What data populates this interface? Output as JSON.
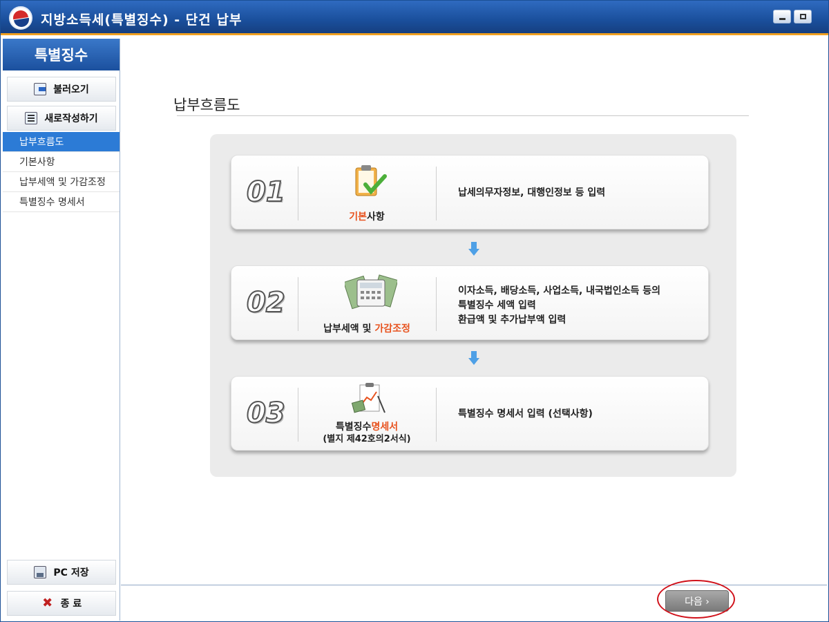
{
  "window": {
    "title": "지방소득세(특별징수) - 단건 납부"
  },
  "sidebar": {
    "header": "특별징수",
    "load_label": "불러오기",
    "new_label": "새로작성하기",
    "items": [
      {
        "label": "납부흐름도",
        "active": true
      },
      {
        "label": "기본사항",
        "active": false
      },
      {
        "label": "납부세액 및 가감조정",
        "active": false
      },
      {
        "label": "특별징수 명세서",
        "active": false
      }
    ],
    "save_label": "PC 저장",
    "exit_label": "종 료"
  },
  "main": {
    "title": "납부흐름도",
    "steps": [
      {
        "number": "01",
        "label_highlight": "기본",
        "label_rest": "사항",
        "icon": "clipboard-check-icon",
        "desc": [
          "납세의무자정보, 대행인정보 등 입력"
        ]
      },
      {
        "number": "02",
        "label_plain": "납부세액 및 ",
        "label_highlight": "가감조정",
        "icon": "calculator-money-icon",
        "desc": [
          "이자소득, 배당소득, 사업소득, 내국법인소득 등의",
          "특별징수 세액 입력",
          "환급액 및 추가납부액 입력"
        ]
      },
      {
        "number": "03",
        "label_plain": "특별징수",
        "label_highlight": "명세서",
        "label_sub": "(별지 제42호의2서식)",
        "icon": "statement-chart-icon",
        "desc": [
          "특별징수 명세서 입력 (선택사항)"
        ]
      }
    ],
    "next_label": "다음 ›"
  },
  "colors": {
    "accent": "#1b509e",
    "highlight": "#e8531f",
    "active_menu": "#2c7bd6"
  }
}
